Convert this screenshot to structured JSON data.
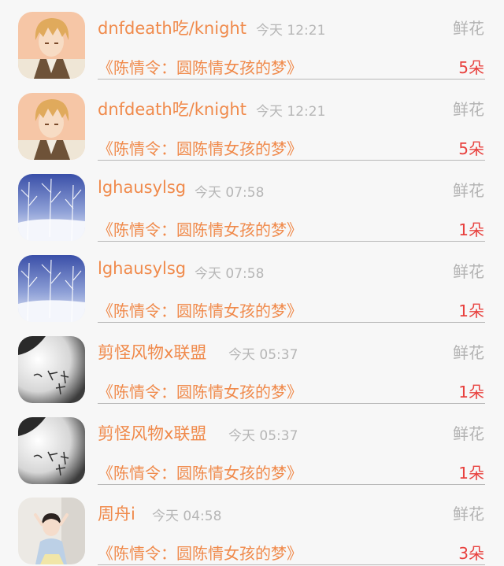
{
  "items": [
    {
      "user": "dnfdeath吃/knight",
      "time": "今天 12:21",
      "type": "鲜花",
      "novel": "《陈情令：圆陈情女孩的梦》",
      "amount": "5朵",
      "avatar": "anime-boy-avatar"
    },
    {
      "user": "dnfdeath吃/knight",
      "time": "今天 12:21",
      "type": "鲜花",
      "novel": "《陈情令：圆陈情女孩的梦》",
      "amount": "5朵",
      "avatar": "anime-boy-avatar"
    },
    {
      "user": "lghausylsg",
      "time": "今天 07:58",
      "type": "鲜花",
      "novel": "《陈情令：圆陈情女孩的梦》",
      "amount": "1朵",
      "avatar": "snowy-forest-avatar"
    },
    {
      "user": "lghausylsg",
      "time": "今天 07:58",
      "type": "鲜花",
      "novel": "《陈情令：圆陈情女孩的梦》",
      "amount": "1朵",
      "avatar": "snowy-forest-avatar"
    },
    {
      "user": "剪怪风物x联盟",
      "time": "今天 05:37",
      "type": "鲜花",
      "novel": "《陈情令：圆陈情女孩的梦》",
      "amount": "1朵",
      "avatar": "ink-calligraphy-avatar"
    },
    {
      "user": "剪怪风物x联盟",
      "time": "今天 05:37",
      "type": "鲜花",
      "novel": "《陈情令：圆陈情女孩的梦》",
      "amount": "1朵",
      "avatar": "ink-calligraphy-avatar"
    },
    {
      "user": "周舟i",
      "time": "今天 04:58",
      "type": "鲜花",
      "novel": "《陈情令：圆陈情女孩的梦》",
      "amount": "3朵",
      "avatar": "girl-photo-avatar"
    }
  ],
  "colors": {
    "username": "#f08a4b",
    "novel_title": "#f08a4b",
    "amount": "#e8413e",
    "muted": "#b6b6b6",
    "background": "#f7f7f7"
  }
}
